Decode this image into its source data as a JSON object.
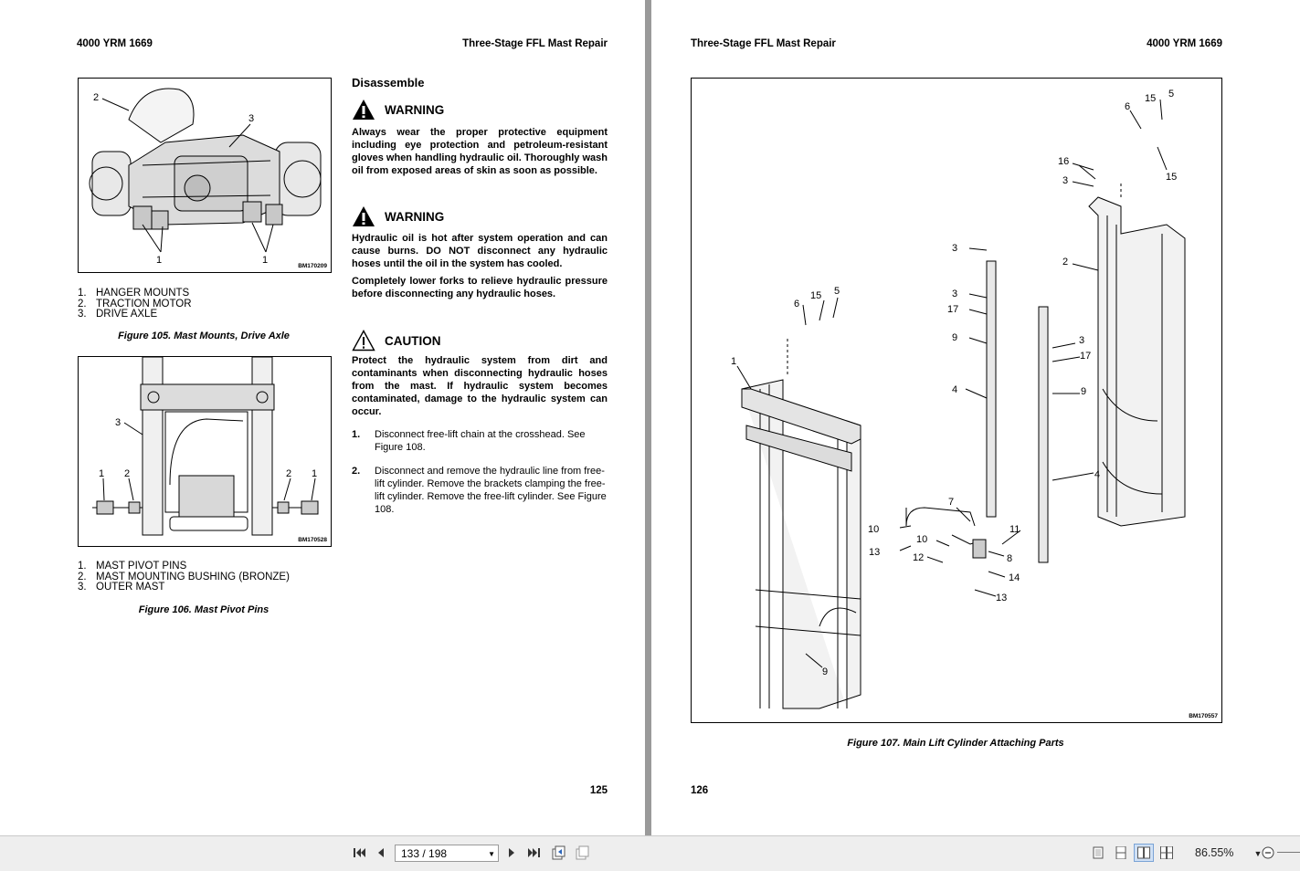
{
  "left_page": {
    "header_left": "4000 YRM 1669",
    "header_right": "Three-Stage FFL Mast Repair",
    "page_number": "125",
    "figure105": {
      "code": "BM170209",
      "callouts": [
        "1",
        "1",
        "2",
        "3"
      ],
      "legend": [
        {
          "num": "1.",
          "text": "HANGER MOUNTS"
        },
        {
          "num": "2.",
          "text": "TRACTION MOTOR"
        },
        {
          "num": "3.",
          "text": "DRIVE AXLE"
        }
      ],
      "caption": "Figure 105. Mast Mounts, Drive Axle"
    },
    "figure106": {
      "code": "BM170528",
      "callouts": [
        "1",
        "2",
        "3",
        "2",
        "1"
      ],
      "legend": [
        {
          "num": "1.",
          "text": "MAST PIVOT PINS"
        },
        {
          "num": "2.",
          "text": "MAST MOUNTING BUSHING (BRONZE)"
        },
        {
          "num": "3.",
          "text": "OUTER MAST"
        }
      ],
      "caption": "Figure 106. Mast Pivot Pins"
    },
    "section_title": "Disassemble",
    "warning1": {
      "label": "WARNING",
      "text": "Always wear the proper protective equipment including eye protection and petroleum-resistant gloves when handling hydraulic oil. Thoroughly wash oil from exposed areas of skin as soon as possible."
    },
    "warning2": {
      "label": "WARNING",
      "text1": "Hydraulic oil is hot after system operation and can cause burns. DO NOT disconnect any hydraulic hoses until the oil in the system has cooled.",
      "text2": "Completely lower forks to relieve hydraulic pressure before disconnecting any hydraulic hoses."
    },
    "caution": {
      "label": "CAUTION",
      "text": "Protect the hydraulic system from dirt and contaminants when disconnecting hydraulic hoses from the mast. If hydraulic system becomes contaminated, damage to the hydraulic system can occur."
    },
    "steps": [
      {
        "num": "1.",
        "text": "Disconnect free-lift chain at the crosshead. See Figure 108."
      },
      {
        "num": "2.",
        "text": "Disconnect and remove the hydraulic line from free-lift cylinder. Remove the brackets clamping the free-lift cylinder. Remove the free-lift cylinder. See Figure 108."
      }
    ]
  },
  "right_page": {
    "header_left": "Three-Stage FFL Mast Repair",
    "header_right": "4000 YRM 1669",
    "page_number": "126",
    "figure107": {
      "code": "BM170557",
      "callouts": [
        "15",
        "5",
        "6",
        "15",
        "16",
        "3",
        "2",
        "3",
        "3",
        "17",
        "9",
        "6",
        "15",
        "5",
        "1",
        "3",
        "17",
        "9",
        "4",
        "4",
        "7",
        "11",
        "10",
        "10",
        "8",
        "13",
        "12",
        "14",
        "13",
        "9"
      ],
      "caption": "Figure 107. Main Lift Cylinder Attaching Parts"
    }
  },
  "toolbar": {
    "page_field": "133 / 198",
    "zoom": "86.55%"
  },
  "colors": {
    "viewer_bg": "#ababab",
    "toolbar_bg": "#eeeeee",
    "active_view": "#cfe0f5"
  }
}
